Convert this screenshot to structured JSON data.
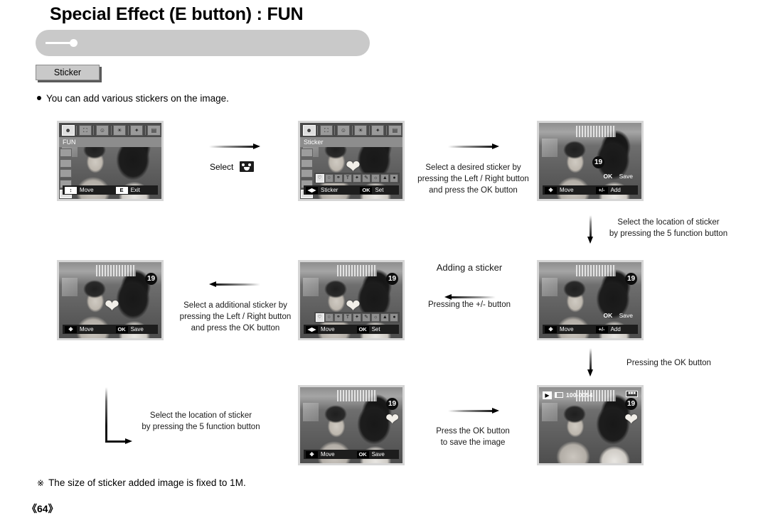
{
  "header": {
    "title": "Special Effect (E button) : FUN"
  },
  "section_tab": {
    "label": "Sticker"
  },
  "intro": {
    "bullet_text": "You can add various stickers on the image."
  },
  "footnote": {
    "mark": "※",
    "text": "The size of sticker added image is fixed to 1M."
  },
  "page": {
    "number": "《64》"
  },
  "annotations": {
    "select_label": "Select",
    "step1": "Select a desired sticker by\npressing the Left / Right button\nand press the OK button",
    "step2": "Select the location of sticker\nby pressing the 5 function button",
    "step3": "Select a additional sticker by\npressing the Left / Right button\nand press the OK button",
    "step4_title": "Adding a sticker",
    "step4": "Pressing the +/- button",
    "step5": "Pressing the OK button",
    "step6": "Select the location of sticker\nby pressing the 5 function button",
    "step7": "Press the OK button\nto save the image"
  },
  "screens": {
    "s1": {
      "name": "fun-menu-screen",
      "menu_title": "FUN",
      "menu_icons": [
        "smiley-face-icon",
        "photo-frame-icon",
        "mask-icon",
        "palette-icon",
        "magic-wand-icon",
        "composite-image-icon"
      ],
      "active_menu_index": 0,
      "side_icons": [
        "preset-focus-icon",
        "highlight-icon",
        "composite-icon",
        "frame-icon",
        "sticker-icon"
      ],
      "active_side_index": 4,
      "status": [
        {
          "key": "↕",
          "label": "Move"
        },
        {
          "key": "E",
          "label": "Exit"
        }
      ]
    },
    "s2": {
      "name": "sticker-select-screen",
      "menu_title": "Sticker",
      "menu_icons": [
        "smiley-face-icon",
        "photo-frame-icon",
        "mask-icon",
        "palette-icon",
        "magic-wand-icon",
        "composite-image-icon"
      ],
      "active_menu_index": 0,
      "side_icons": [
        "preset-focus-icon",
        "highlight-icon",
        "composite-icon",
        "frame-icon",
        "sticker-icon"
      ],
      "active_side_index": 4,
      "sticker_items": [
        "heart-sticker",
        "clock-sticker",
        "glasses-sticker",
        "text-sticker",
        "star-sticker",
        "pencil-sticker",
        "sun-sticker",
        "hat-sticker",
        "drop-sticker"
      ],
      "active_sticker_index": 0,
      "status": [
        {
          "key": "◀▶",
          "label": "Sticker"
        },
        {
          "key": "OK",
          "label": "Set"
        }
      ]
    },
    "s3": {
      "name": "sticker-placed-screen",
      "badge": "19",
      "hint_key": "OK",
      "hint_label": "Save",
      "status": [
        {
          "key": "✥",
          "label": "Move"
        },
        {
          "key": "+/-",
          "label": "Add"
        }
      ]
    },
    "s4": {
      "name": "sticker-second-placed-screen",
      "badge": "19",
      "status": [
        {
          "key": "✥",
          "label": "Move"
        },
        {
          "key": "OK",
          "label": "Save"
        }
      ]
    },
    "s5": {
      "name": "sticker-second-select-screen",
      "badge": "19",
      "sticker_items": [
        "heart-sticker",
        "clock-sticker",
        "glasses-sticker",
        "text-sticker",
        "star-sticker",
        "pencil-sticker",
        "sun-sticker",
        "hat-sticker",
        "drop-sticker"
      ],
      "active_sticker_index": 0,
      "status": [
        {
          "key": "◀▶",
          "label": "Move"
        },
        {
          "key": "OK",
          "label": "Set"
        }
      ]
    },
    "s6": {
      "name": "sticker-add-screen",
      "badge": "19",
      "hint_key": "OK",
      "hint_label": "Save",
      "status": [
        {
          "key": "✥",
          "label": "Move"
        },
        {
          "key": "+/-",
          "label": "Add"
        }
      ]
    },
    "s7": {
      "name": "sticker-move-screen",
      "badge": "19",
      "status": [
        {
          "key": "✥",
          "label": "Move"
        },
        {
          "key": "OK",
          "label": "Save"
        }
      ]
    },
    "s8": {
      "name": "playback-saved-screen",
      "badge": "19",
      "file_number": "100-0054",
      "play_icon": "▶",
      "battery_icon": "battery-full-icon"
    }
  },
  "colors": {
    "header_pill": "#c9c9c9",
    "tab_fill": "#c9c9c9",
    "text": "#000000",
    "lcd_border": "#d6d6d6"
  }
}
